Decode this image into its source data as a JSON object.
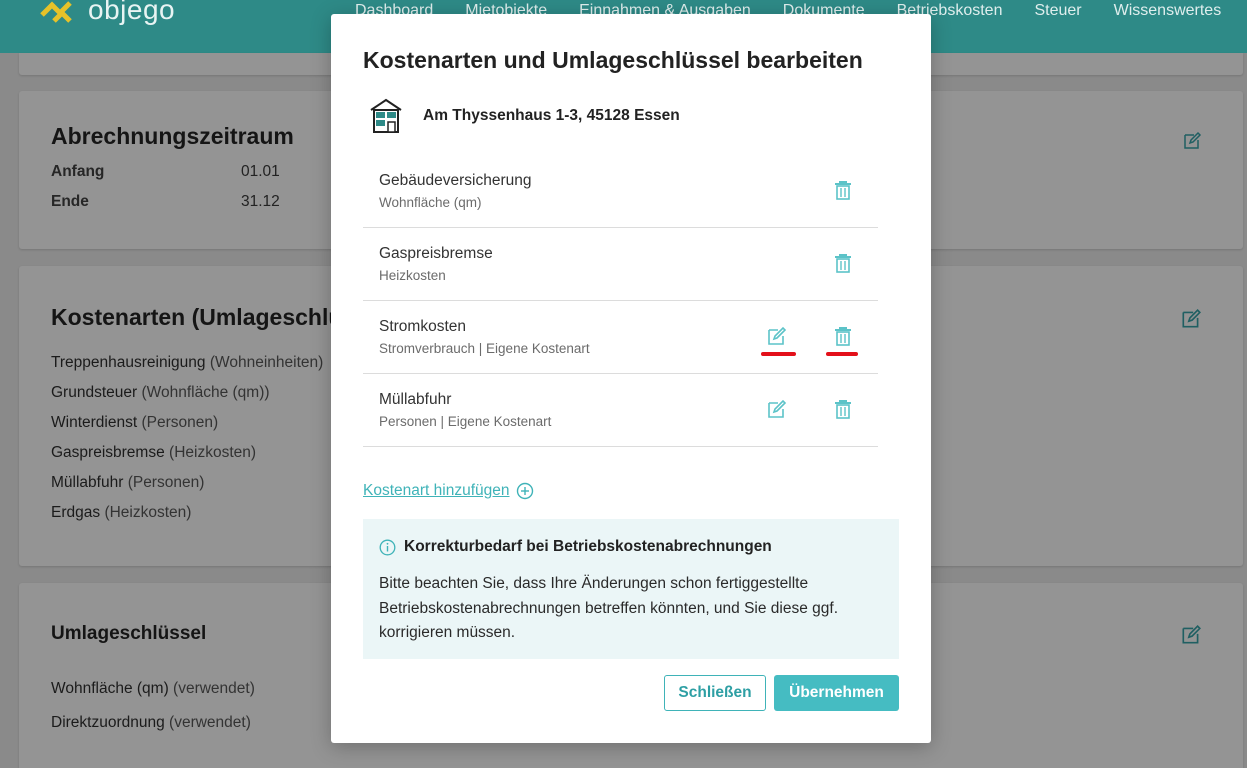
{
  "app": {
    "logo_text": "objego",
    "nav": [
      "Dashboard",
      "Mietobjekte",
      "Einnahmen & Ausgaben",
      "Dokumente",
      "Betriebskosten",
      "Steuer",
      "Wissenswertes"
    ]
  },
  "background": {
    "period": {
      "title": "Abrechnungszeitraum",
      "rows": [
        {
          "label": "Anfang",
          "value": "01.01"
        },
        {
          "label": "Ende",
          "value": "31.12"
        }
      ]
    },
    "cost_types": {
      "title": "Kostenarten (Umlageschlü",
      "items": [
        {
          "name": "Treppenhausreinigung",
          "key": "(Wohneinheiten)"
        },
        {
          "name": "Grundsteuer",
          "key": "(Wohnfläche (qm))"
        },
        {
          "name": "Winterdienst",
          "key": "(Personen)"
        },
        {
          "name": "Gaspreisbremse",
          "key": "(Heizkosten)"
        },
        {
          "name": "Müllabfuhr",
          "key": "(Personen)"
        },
        {
          "name": "Erdgas",
          "key": "(Heizkosten)"
        }
      ]
    },
    "keys": {
      "title": "Umlageschlüssel",
      "items": [
        {
          "name": "Wohnfläche (qm)",
          "status": "(verwendet)"
        },
        {
          "name": "Direktzuordnung",
          "status": "(verwendet)"
        }
      ]
    }
  },
  "modal": {
    "title": "Kostenarten und Umlageschlüssel bearbeiten",
    "property_address": "Am Thyssenhaus 1-3, 45128 Essen",
    "items": [
      {
        "name": "Gebäudeversicherung",
        "sub": "Wohnfläche (qm)",
        "editable": false
      },
      {
        "name": "Gaspreisbremse",
        "sub": "Heizkosten",
        "editable": false
      },
      {
        "name": "Stromkosten",
        "sub": "Stromverbrauch | Eigene Kostenart",
        "editable": true
      },
      {
        "name": "Müllabfuhr",
        "sub": "Personen | Eigene Kostenart",
        "editable": true
      }
    ],
    "add_link": "Kostenart hinzufügen",
    "info": {
      "title": "Korrekturbedarf bei Betriebskostenabrechnungen",
      "text": "Bitte beachten Sie, dass Ihre Änderungen schon fertiggestellte Betriebskostenabrechnungen betreffen könnten, und Sie diese ggf. korrigieren müssen."
    },
    "buttons": {
      "close": "Schließen",
      "apply": "Übernehmen"
    }
  },
  "colors": {
    "accent": "#45bcc2",
    "topbar": "#2e8a87",
    "highlight": "#e3101a"
  }
}
